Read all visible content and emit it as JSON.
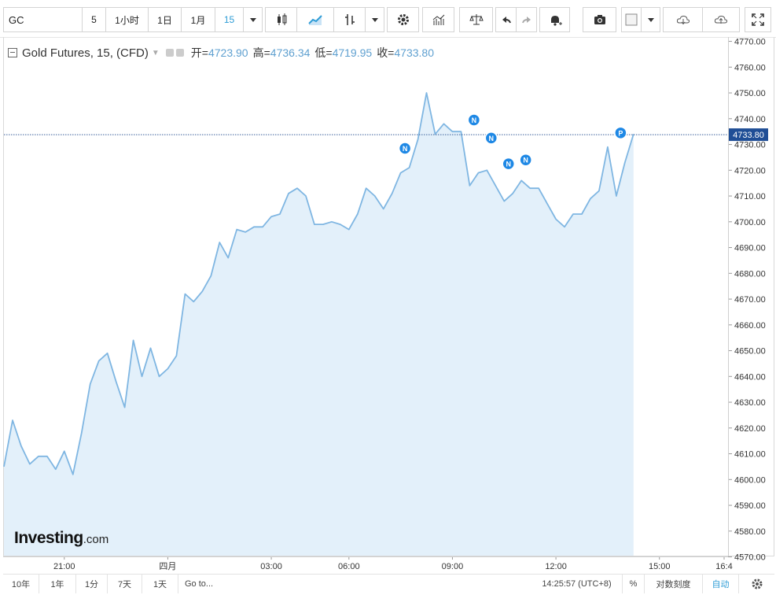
{
  "toolbar": {
    "symbol": "GC",
    "intervals": [
      "5",
      "1小时",
      "1日",
      "1月",
      "15"
    ],
    "active_interval": "15"
  },
  "legend": {
    "title": "Gold Futures, 15, (CFD)",
    "open_label": "开=",
    "open": "4723.90",
    "high_label": "高=",
    "high": "4736.34",
    "low_label": "低=",
    "low": "4719.95",
    "close_label": "收=",
    "close": "4733.80"
  },
  "price_badge": "4733.80",
  "watermark": {
    "main": "Investing",
    "suffix": ".com"
  },
  "bottombar": {
    "ranges": [
      "10年",
      "1年",
      "1分",
      "7天",
      "1天"
    ],
    "goto": "Go to...",
    "time": "14:25:57 (UTC+8)",
    "percent": "%",
    "log": "对数刻度",
    "auto": "自动"
  },
  "colors": {
    "line": "#7fb6e2",
    "area": "#e3f0fa",
    "accent": "#2e9cd6",
    "marker": "#1e88e5"
  },
  "chart_data": {
    "type": "area",
    "y_ticks": [
      4570,
      4580,
      4590,
      4600,
      4610,
      4620,
      4630,
      4640,
      4650,
      4660,
      4670,
      4680,
      4690,
      4700,
      4710,
      4720,
      4730,
      4740,
      4750,
      4760,
      4770
    ],
    "ylim": [
      4570,
      4772
    ],
    "x_ticks": [
      "21:00",
      "四月",
      "03:00",
      "06:00",
      "09:00",
      "12:00",
      "15:00",
      "16:4"
    ],
    "xlim": [
      0,
      83.5
    ],
    "last_value": 4733.8,
    "grid": false,
    "series": [
      {
        "values": [
          4605,
          4623,
          4613,
          4606,
          4609,
          4609,
          4604,
          4611,
          4602,
          4618,
          4637,
          4646,
          4649,
          4638,
          4628,
          4654,
          4640,
          4651,
          4640,
          4643,
          4648,
          4672,
          4669,
          4673,
          4679,
          4692,
          4686,
          4697,
          4696,
          4698,
          4698,
          4702,
          4703,
          4711,
          4713,
          4710,
          4699,
          4699,
          4700,
          4699,
          4697,
          4703,
          4713,
          4710,
          4705,
          4711,
          4719,
          4721,
          4732,
          4750,
          4734,
          4738,
          4735,
          4735,
          4714,
          4719,
          4720,
          4714,
          4708,
          4711,
          4716,
          4713,
          4713,
          4707,
          4701,
          4698,
          4703,
          4703,
          4709,
          4712,
          4729,
          4710,
          4723,
          4734
        ]
      }
    ],
    "markers": [
      {
        "label": "N",
        "x": 46.5,
        "y": 4728.5
      },
      {
        "label": "N",
        "x": 54.5,
        "y": 4739.5
      },
      {
        "label": "N",
        "x": 56.5,
        "y": 4732.5
      },
      {
        "label": "N",
        "x": 58.5,
        "y": 4722.5
      },
      {
        "label": "N",
        "x": 60.5,
        "y": 4724.0
      },
      {
        "label": "P",
        "x": 71.5,
        "y": 4734.5
      }
    ]
  }
}
